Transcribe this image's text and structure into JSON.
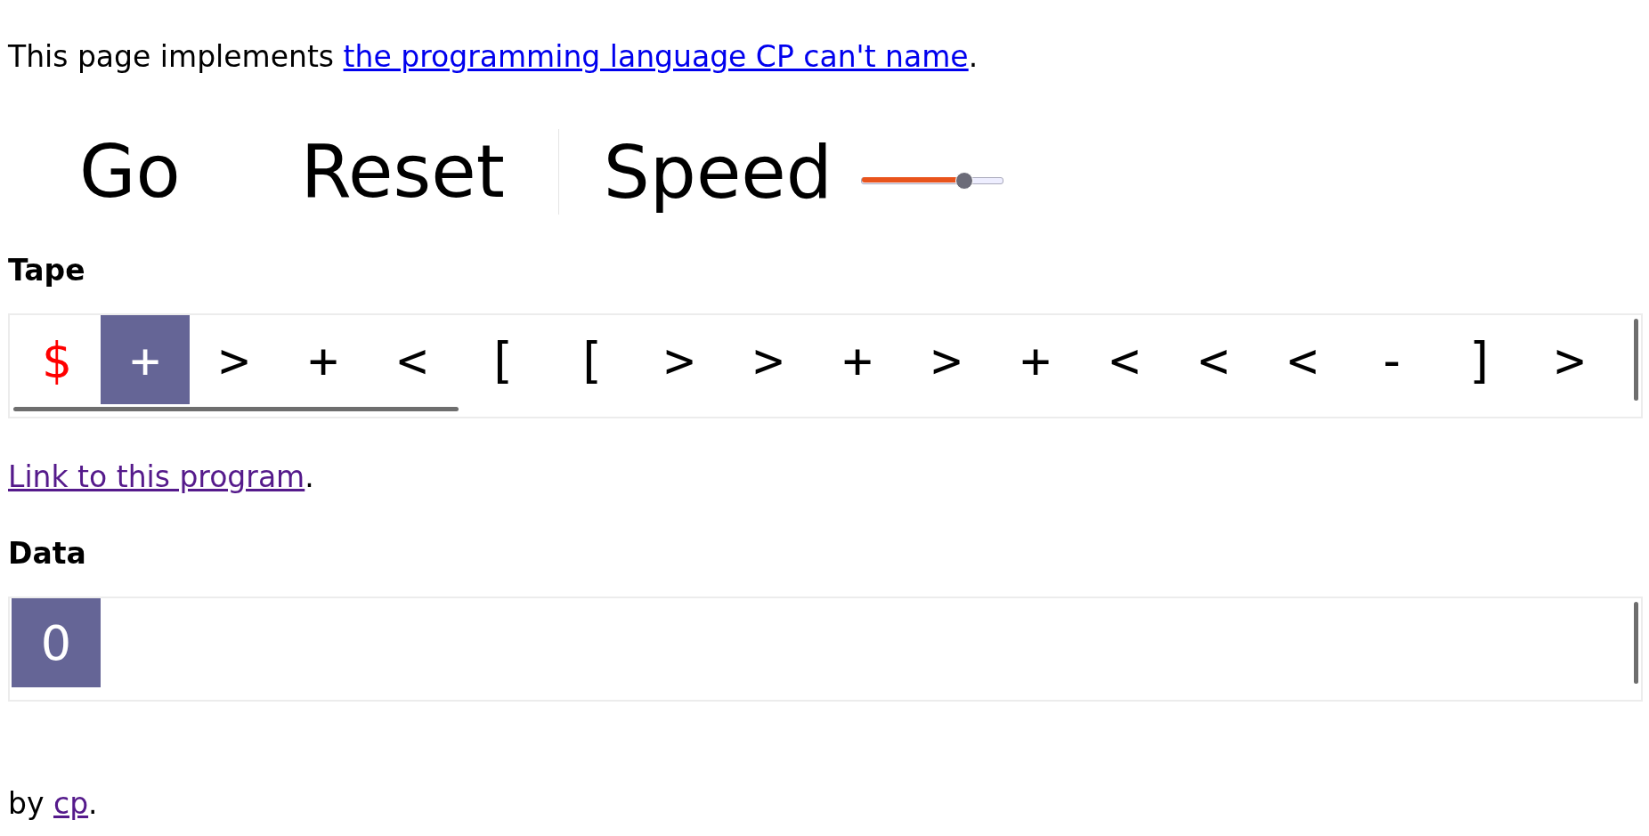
{
  "intro": {
    "text": "This page implements ",
    "link": "the programming language CP can't name",
    "end": "."
  },
  "controls": {
    "go": "Go",
    "reset": "Reset",
    "speed_label": "Speed",
    "speed": {
      "level": 0.72
    }
  },
  "tape": {
    "heading": "Tape",
    "cells": [
      {
        "symbol": "$",
        "kind": "marker",
        "selected": false
      },
      {
        "symbol": "+",
        "kind": "command",
        "selected": true
      },
      {
        "symbol": ">",
        "kind": "command",
        "selected": false
      },
      {
        "symbol": "+",
        "kind": "command",
        "selected": false
      },
      {
        "symbol": "<",
        "kind": "command",
        "selected": false
      },
      {
        "symbol": "[",
        "kind": "command",
        "selected": false
      },
      {
        "symbol": "[",
        "kind": "command",
        "selected": false
      },
      {
        "symbol": ">",
        "kind": "command",
        "selected": false
      },
      {
        "symbol": ">",
        "kind": "command",
        "selected": false
      },
      {
        "symbol": "+",
        "kind": "command",
        "selected": false
      },
      {
        "symbol": ">",
        "kind": "command",
        "selected": false
      },
      {
        "symbol": "+",
        "kind": "command",
        "selected": false
      },
      {
        "symbol": "<",
        "kind": "command",
        "selected": false
      },
      {
        "symbol": "<",
        "kind": "command",
        "selected": false
      },
      {
        "symbol": "<",
        "kind": "command",
        "selected": false
      },
      {
        "symbol": "-",
        "kind": "command",
        "selected": false
      },
      {
        "symbol": "]",
        "kind": "command",
        "selected": false
      },
      {
        "symbol": ">",
        "kind": "command",
        "selected": false
      }
    ]
  },
  "program_link": {
    "link": "Link to this program",
    "end": "."
  },
  "data": {
    "heading": "Data",
    "cells": [
      {
        "value": "0",
        "selected": true
      }
    ]
  },
  "footer": {
    "text": "by",
    "link": "cp",
    "end": "."
  }
}
